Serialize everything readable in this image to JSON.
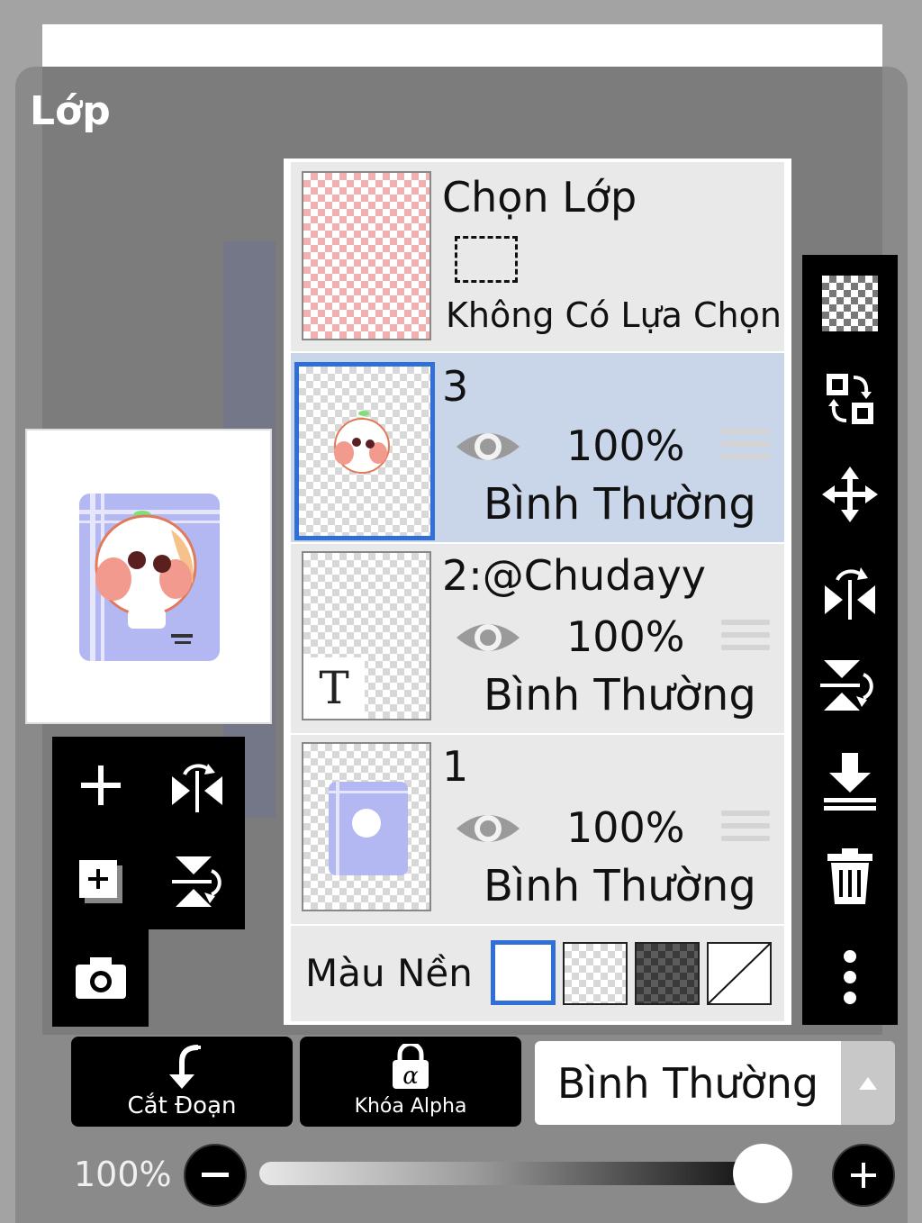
{
  "panel": {
    "title": "Lớp"
  },
  "selection_row": {
    "title": "Chọn Lớp",
    "status": "Không Có Lựa Chọn"
  },
  "layers": [
    {
      "name": "3",
      "opacity": "100%",
      "blend": "Bình Thường",
      "selected": true
    },
    {
      "name": "2:@Chudayy",
      "opacity": "100%",
      "blend": "Bình Thường",
      "selected": false
    },
    {
      "name": "1",
      "opacity": "100%",
      "blend": "Bình Thường",
      "selected": false
    }
  ],
  "background": {
    "label": "Màu Nền"
  },
  "text_layer_badge": "T",
  "bottom_bar": {
    "clip_label": "Cắt Đoạn",
    "alpha_lock_label": "Khóa Alpha",
    "blend_mode": "Bình Thường"
  },
  "opacity": {
    "label": "100%",
    "value": 1.0
  },
  "colors": {
    "selected_row": "#c9d6ea",
    "accent_blue": "#2f6fd6",
    "panel_gray": "#8a8a8a"
  },
  "icons": {
    "right_tools": [
      "transparent-layer-icon",
      "swap-layers-icon",
      "move-icon",
      "flip-horizontal-icon",
      "flip-vertical-icon",
      "merge-down-icon",
      "trash-icon",
      "more-vertical-icon"
    ],
    "left_tools": [
      "add-layer-icon",
      "flip-horizontal-icon",
      "add-copy-layer-icon",
      "flip-vertical-icon",
      "camera-icon"
    ]
  }
}
